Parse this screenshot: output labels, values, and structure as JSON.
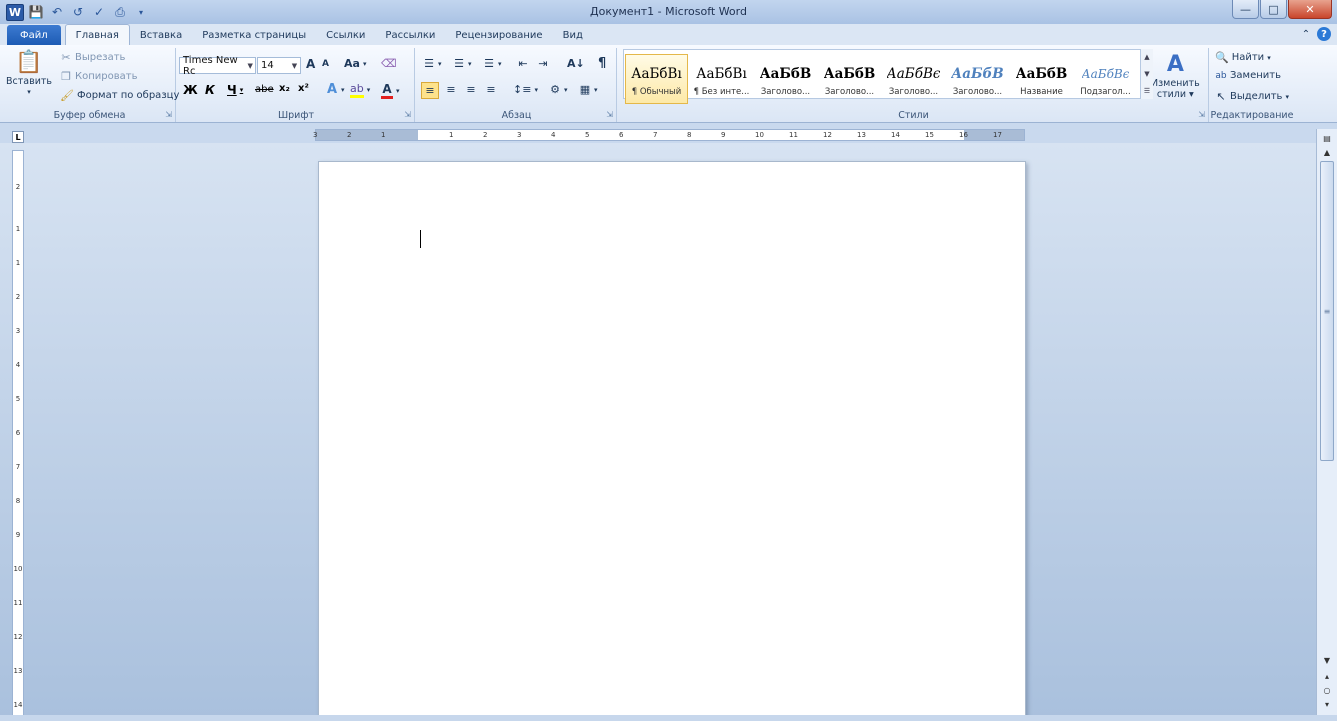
{
  "window": {
    "title": "Документ1 - Microsoft Word"
  },
  "qat": {
    "logo": "W",
    "items": [
      "save-icon",
      "undo-icon",
      "redo-icon",
      "spelling-icon",
      "print-preview-icon",
      "customize-icon"
    ]
  },
  "tabs": [
    {
      "label": "Файл"
    },
    {
      "label": "Главная"
    },
    {
      "label": "Вставка"
    },
    {
      "label": "Разметка страницы"
    },
    {
      "label": "Ссылки"
    },
    {
      "label": "Рассылки"
    },
    {
      "label": "Рецензирование"
    },
    {
      "label": "Вид"
    }
  ],
  "clipboard": {
    "paste": "Вставить",
    "cut": "Вырезать",
    "copy": "Копировать",
    "format_painter": "Формат по образцу",
    "label": "Буфер обмена"
  },
  "font": {
    "name": "Times New Rc",
    "size": "14",
    "label": "Шрифт",
    "grow": "A",
    "shrink": "A",
    "case": "Aa",
    "bold": "Ж",
    "italic": "К",
    "underline": "Ч",
    "strike": "abe",
    "sub": "x₂",
    "sup": "x²",
    "color_letter": "A"
  },
  "paragraph": {
    "label": "Абзац",
    "pilcrow": "¶"
  },
  "styles": {
    "label": "Стили",
    "items": [
      {
        "preview": "АаБбВı",
        "name": "¶ Обычный"
      },
      {
        "preview": "АаБбВı",
        "name": "¶ Без инте..."
      },
      {
        "preview": "АаБбВ",
        "name": "Заголово..."
      },
      {
        "preview": "АаБбВ",
        "name": "Заголово..."
      },
      {
        "preview": "АаБбВє",
        "name": "Заголово..."
      },
      {
        "preview": "АаБбВ",
        "name": "Заголово..."
      },
      {
        "preview": "АаБбВ",
        "name": "Название"
      },
      {
        "preview": "АаБбВє",
        "name": "Подзагол..."
      }
    ],
    "change_line1": "Изменить",
    "change_line2": "стили"
  },
  "editing": {
    "find": "Найти",
    "replace": "Заменить",
    "select": "Выделить",
    "label": "Редактирование"
  },
  "ruler": {
    "corner": "L",
    "h_labels": [
      "3",
      "2",
      "1",
      "1",
      "2",
      "3",
      "4",
      "5",
      "6",
      "7",
      "8",
      "9",
      "10",
      "11",
      "12",
      "13",
      "14",
      "15",
      "16",
      "17"
    ],
    "v_labels": [
      "2",
      "1",
      "1",
      "2",
      "3",
      "4",
      "5",
      "6",
      "7",
      "8",
      "9",
      "10",
      "11",
      "12",
      "13",
      "14"
    ]
  },
  "colors": {
    "accent": "#2b579a",
    "file_tab": "#1d5bb4",
    "page": "#ffffff"
  }
}
